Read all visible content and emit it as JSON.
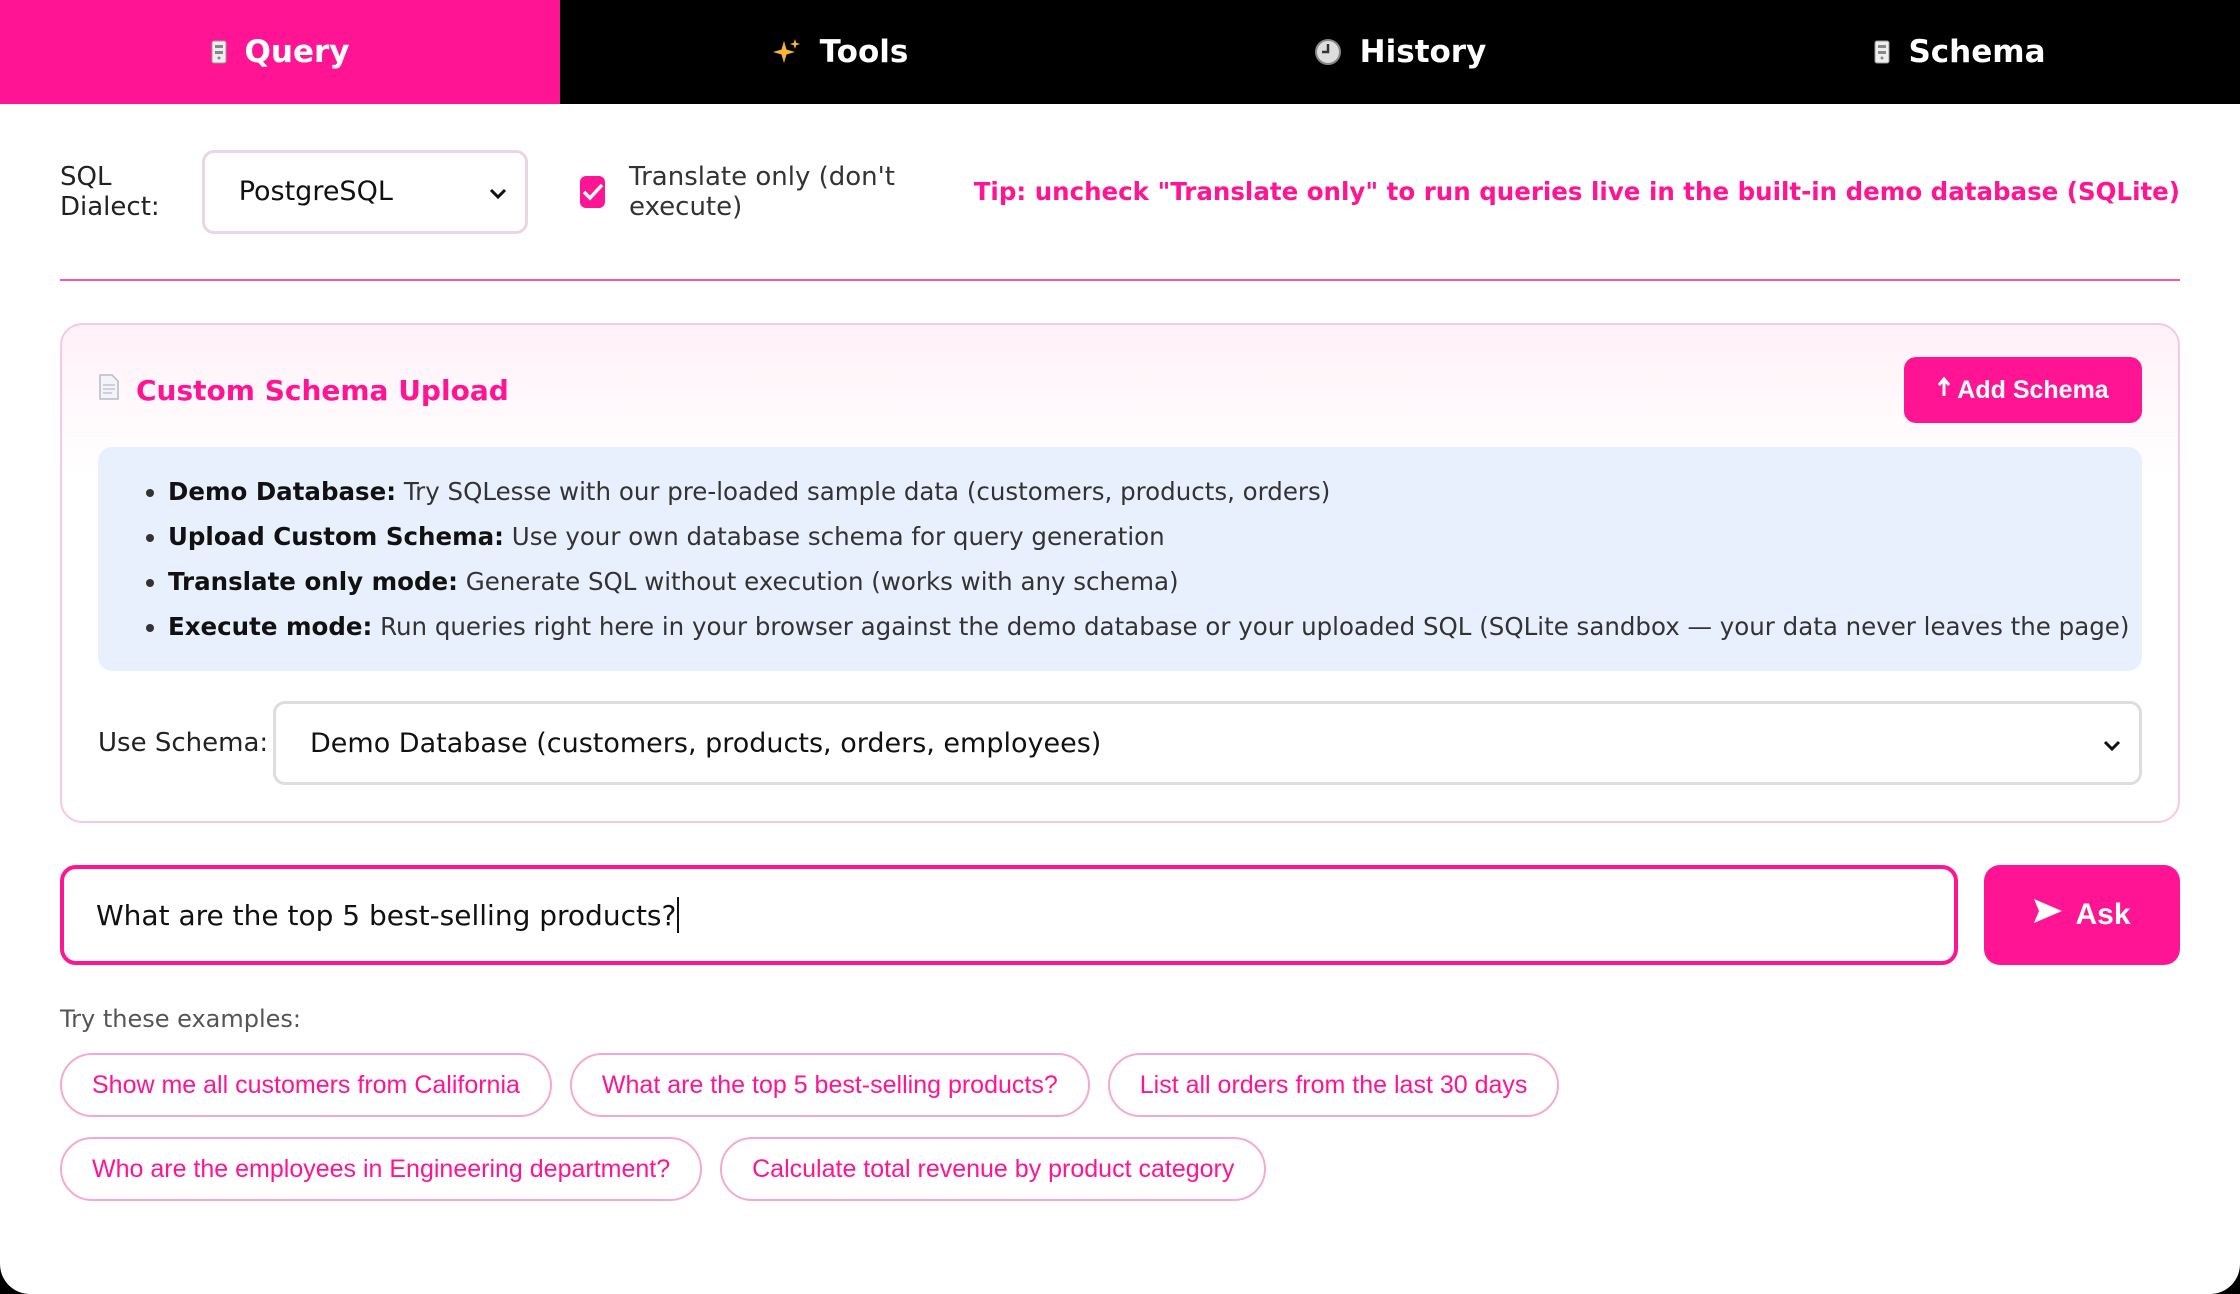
{
  "tabs": [
    {
      "label": "Query",
      "icon": "database-icon"
    },
    {
      "label": "Tools",
      "icon": "sparkles-icon"
    },
    {
      "label": "History",
      "icon": "clock-icon"
    },
    {
      "label": "Schema",
      "icon": "database-icon"
    }
  ],
  "active_tab": "Query",
  "dialect": {
    "label": "SQL Dialect:",
    "selected": "PostgreSQL"
  },
  "translate_only": {
    "label": "Translate only (don't execute)",
    "checked": true
  },
  "tip": "Tip: uncheck \"Translate only\" to run queries live in the built-in demo database (SQLite)",
  "schema_card": {
    "title": "Custom Schema Upload",
    "add_button": "Add Schema",
    "info": [
      {
        "term": "Demo Database:",
        "text": " Try SQLesse with our pre-loaded sample data (customers, products, orders)"
      },
      {
        "term": "Upload Custom Schema:",
        "text": " Use your own database schema for query generation"
      },
      {
        "term": "Translate only mode:",
        "text": " Generate SQL without execution (works with any schema)"
      },
      {
        "term": "Execute mode:",
        "text": " Run queries right here in your browser against the demo database or your uploaded SQL (SQLite sandbox — your data never leaves the page)"
      }
    ],
    "use_schema_label": "Use Schema:",
    "use_schema_selected": "Demo Database (customers, products, orders, employees)"
  },
  "query": {
    "value": "What are the top 5 best-selling products?",
    "ask_label": "Ask"
  },
  "examples": {
    "label": "Try these examples:",
    "items": [
      "Show me all customers from California",
      "What are the top 5 best-selling products?",
      "List all orders from the last 30 days",
      "Who are the employees in Engineering department?",
      "Calculate total revenue by product category"
    ]
  },
  "colors": {
    "accent": "#ff1493",
    "tabbar": "#000000",
    "info_bg": "#e9f0fd"
  }
}
